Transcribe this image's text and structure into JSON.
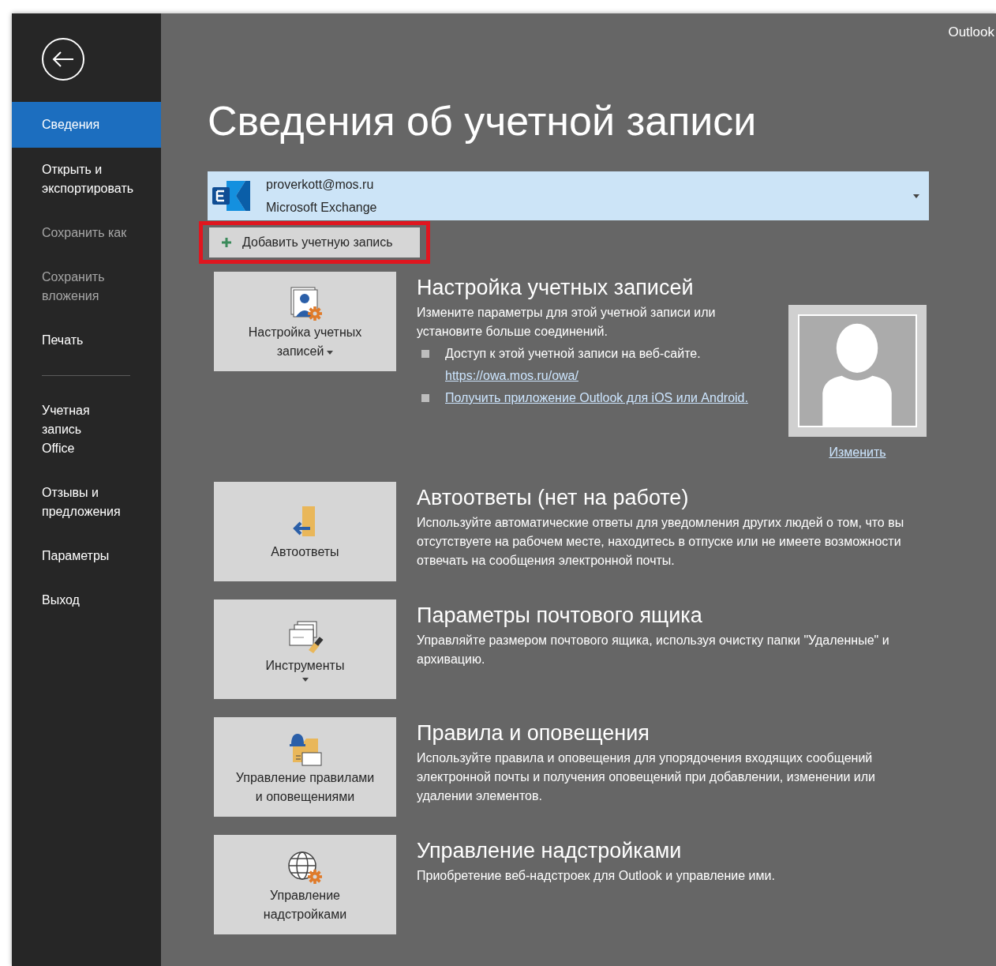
{
  "app_name": "Outlook",
  "sidebar": [
    {
      "kind": "item",
      "lines": [
        "Сведения"
      ],
      "selected": true,
      "disabled": false
    },
    {
      "kind": "item",
      "lines": [
        "Открыть и",
        "экспортировать"
      ],
      "selected": false,
      "disabled": false
    },
    {
      "kind": "item",
      "lines": [
        "Сохранить как"
      ],
      "selected": false,
      "disabled": true
    },
    {
      "kind": "item",
      "lines": [
        "Сохранить",
        "вложения"
      ],
      "selected": false,
      "disabled": true
    },
    {
      "kind": "item",
      "lines": [
        "Печать"
      ],
      "selected": false,
      "disabled": false
    },
    {
      "kind": "divider"
    },
    {
      "kind": "item",
      "lines": [
        "Учетная",
        "запись",
        "Office"
      ],
      "selected": false,
      "disabled": false
    },
    {
      "kind": "item",
      "lines": [
        "Отзывы и",
        "предложения"
      ],
      "selected": false,
      "disabled": false
    },
    {
      "kind": "item",
      "lines": [
        "Параметры"
      ],
      "selected": false,
      "disabled": false
    },
    {
      "kind": "item",
      "lines": [
        "Выход"
      ],
      "selected": false,
      "disabled": false
    }
  ],
  "title": "Сведения об учетной записи",
  "account": {
    "email": "proverkott@mos.ru",
    "type": "Microsoft Exchange"
  },
  "add_account": {
    "label": "Добавить учетную запись",
    "highlighted": true
  },
  "sections": [
    {
      "button": {
        "lines": [
          "Настройка учетных",
          "записей"
        ],
        "dropdown": true
      },
      "title": "Настройка учетных записей",
      "description": "Измените параметры для этой учетной записи или установите больше соединений.",
      "bullets": [
        {
          "kind": "text",
          "text": "Доступ к этой учетной записи на веб-сайте.",
          "link": "https://owa.mos.ru/owa/"
        },
        {
          "kind": "link",
          "text": "Получить приложение Outlook для iOS или Android."
        }
      ],
      "photo": {
        "link": "Изменить"
      }
    },
    {
      "button": {
        "lines": [
          "Автоответы"
        ],
        "dropdown": false
      },
      "title": "Автоответы (нет на работе)",
      "description": "Используйте автоматические ответы для уведомления других людей о том, что вы отсутствуете на рабочем месте, находитесь в отпуске или не имеете возможности отвечать на сообщения электронной почты."
    },
    {
      "button": {
        "lines": [
          "Инструменты"
        ],
        "dropdown": true
      },
      "title": "Параметры почтового ящика",
      "description": "Управляйте размером почтового ящика, используя очистку папки \"Удаленные\" и архивацию."
    },
    {
      "button": {
        "lines": [
          "Управление правилами",
          "и оповещениями"
        ],
        "dropdown": false
      },
      "title": "Правила и оповещения",
      "description": "Используйте правила и оповещения для упорядочения входящих сообщений электронной почты и получения оповещений при добавлении, изменении или удалении элементов."
    },
    {
      "button": {
        "lines": [
          "Управление",
          "надстройками"
        ],
        "dropdown": false
      },
      "title": "Управление надстройками",
      "description": "Приобретение веб-надстроек для Outlook и управление ими."
    }
  ]
}
